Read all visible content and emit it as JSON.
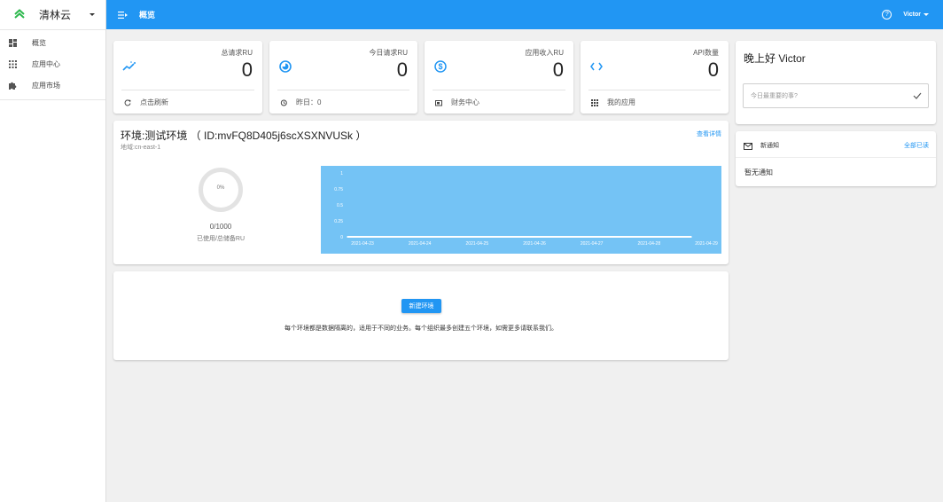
{
  "brand": {
    "name": "清林云",
    "accent": "#2db84d"
  },
  "sidebar": {
    "items": [
      {
        "label": "概览",
        "icon": "dashboard-icon"
      },
      {
        "label": "应用中心",
        "icon": "apps-grid-icon"
      },
      {
        "label": "应用市场",
        "icon": "puzzle-icon"
      }
    ]
  },
  "header": {
    "title": "概览",
    "user": "Victor",
    "color": "#2196f3"
  },
  "stats": [
    {
      "label": "总请求RU",
      "value": "0",
      "footer": "点击刷新",
      "icon": "sparkline-icon",
      "footer_icon": "refresh-icon"
    },
    {
      "label": "今日请求RU",
      "value": "0",
      "footer": "昨日：0",
      "icon": "pie-chart-icon",
      "footer_icon": "history-icon"
    },
    {
      "label": "应用收入RU",
      "value": "0",
      "footer": "财务中心",
      "icon": "dollar-icon",
      "footer_icon": "finance-icon"
    },
    {
      "label": "API数量",
      "value": "0",
      "footer": "我的应用",
      "icon": "code-icon",
      "footer_icon": "apps-icon"
    }
  ],
  "environment": {
    "title": "环境:测试环境 （ ID:mvFQ8D405j6scXSXNVUSk ）",
    "region": "地域:cn-east-1",
    "detail_link": "查看详情",
    "usage_percent": "0%",
    "quota": "0/1000",
    "quota_label": "已使用/总储备RU"
  },
  "chart_data": {
    "type": "line",
    "x": [
      "2021-04-23",
      "2021-04-24",
      "2021-04-25",
      "2021-04-26",
      "2021-04-27",
      "2021-04-28",
      "2021-04-29"
    ],
    "series": [
      {
        "values": [
          0,
          0,
          0,
          0,
          0,
          0,
          0
        ]
      }
    ],
    "yticks": [
      "1",
      "0.75",
      "0.5",
      "0.25",
      "0"
    ],
    "ylim": [
      0,
      1
    ],
    "background": "#74c3f5",
    "line_color": "#ffffff"
  },
  "new_env": {
    "button": "新建环境",
    "description": "每个环境都是数据隔离的，适用于不同的业务。每个组织最多创建五个环境，如需更多请联系我们。"
  },
  "greeting": {
    "text": "晚上好 Victor",
    "todo_placeholder": "今日最重要的事?"
  },
  "notifications": {
    "title": "新通知",
    "all_link": "全部已读",
    "empty": "暂无通知"
  }
}
